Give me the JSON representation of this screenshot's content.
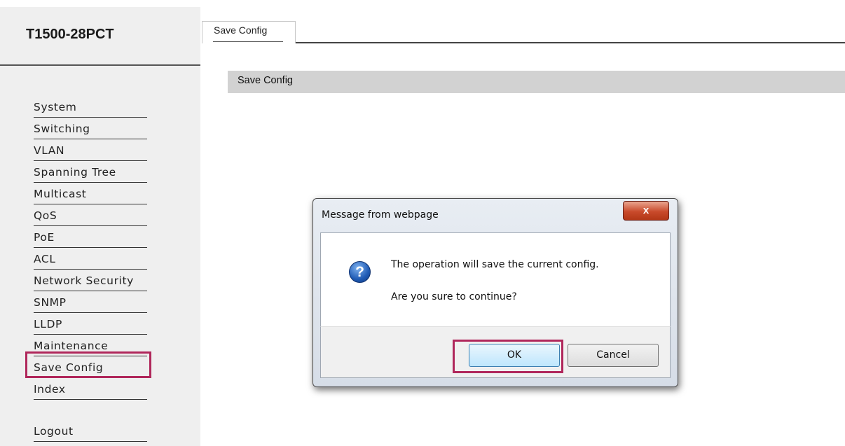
{
  "sidebar": {
    "model": "T1500-28PCT",
    "items": [
      {
        "label": "System"
      },
      {
        "label": "Switching"
      },
      {
        "label": "VLAN"
      },
      {
        "label": "Spanning Tree"
      },
      {
        "label": "Multicast"
      },
      {
        "label": "QoS"
      },
      {
        "label": "PoE"
      },
      {
        "label": "ACL"
      },
      {
        "label": "Network Security"
      },
      {
        "label": "SNMP"
      },
      {
        "label": "LLDP"
      },
      {
        "label": "Maintenance"
      },
      {
        "label": "Save Config"
      },
      {
        "label": "Index"
      }
    ],
    "logout": "Logout",
    "highlighted_item": "Save Config"
  },
  "header": {
    "tab_label": "Save Config"
  },
  "main": {
    "section_title": "Save Config"
  },
  "dialog": {
    "title": "Message from webpage",
    "close_label": "x",
    "icon": "question-icon",
    "message_line1": "The operation will save the current config.",
    "message_line2": "Are you sure to continue?",
    "ok_label": "OK",
    "cancel_label": "Cancel"
  },
  "colors": {
    "highlight": "#b0275b",
    "sidebar_bg": "#efefef",
    "section_bar": "#d2d2d2"
  }
}
